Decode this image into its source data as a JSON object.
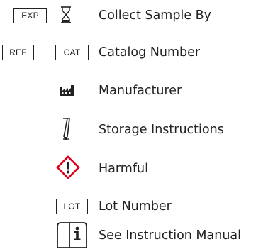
{
  "legend": {
    "collect_sample_by": {
      "box_label": "EXP",
      "icon": "hourglass-icon",
      "label": "Collect Sample By"
    },
    "catalog_number": {
      "box_label_1": "REF",
      "box_label_2": "CAT",
      "label": "Catalog Number"
    },
    "manufacturer": {
      "icon": "factory-icon",
      "label": "Manufacturer"
    },
    "storage_instructions": {
      "icon": "thermometer-icon",
      "label": "Storage Instructions"
    },
    "harmful": {
      "icon": "exclamation-diamond-icon",
      "label": "Harmful",
      "color": "#e0001b"
    },
    "lot_number": {
      "box_label": "LOT",
      "label": "Lot Number"
    },
    "instruction_manual": {
      "icon": "book-info-icon",
      "label": "See Instruction Manual"
    }
  }
}
